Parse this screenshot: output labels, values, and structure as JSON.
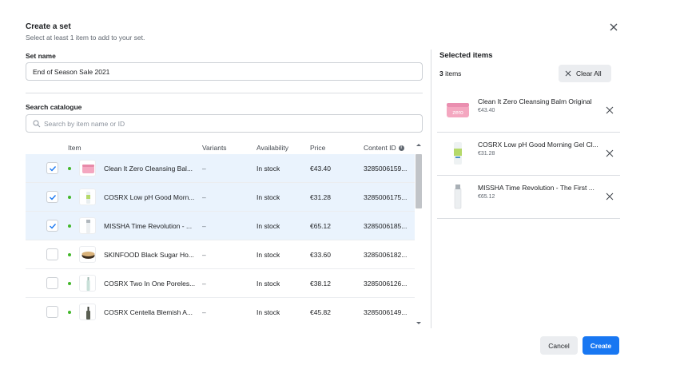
{
  "dialog": {
    "title": "Create a set",
    "subtitle": "Select at least 1 item to add to your set."
  },
  "set_name": {
    "label": "Set name",
    "value": "End of Season Sale 2021"
  },
  "search": {
    "label": "Search catalogue",
    "placeholder": "Search by item name or ID"
  },
  "table": {
    "headers": {
      "item": "Item",
      "variants": "Variants",
      "availability": "Availability",
      "price": "Price",
      "content_id": "Content ID"
    },
    "rows": [
      {
        "name": "Clean It Zero Cleansing Bal...",
        "variants": "–",
        "availability": "In stock",
        "price": "€43.40",
        "content_id": "3285006159...",
        "selected": true
      },
      {
        "name": "COSRX Low pH Good Morn...",
        "variants": "–",
        "availability": "In stock",
        "price": "€31.28",
        "content_id": "3285006175...",
        "selected": true
      },
      {
        "name": "MISSHA Time Revolution - ...",
        "variants": "–",
        "availability": "In stock",
        "price": "€65.12",
        "content_id": "3285006185...",
        "selected": true
      },
      {
        "name": "SKINFOOD Black Sugar Ho...",
        "variants": "–",
        "availability": "In stock",
        "price": "€33.60",
        "content_id": "3285006182...",
        "selected": false
      },
      {
        "name": "COSRX Two In One Poreles...",
        "variants": "–",
        "availability": "In stock",
        "price": "€38.12",
        "content_id": "3285006126...",
        "selected": false
      },
      {
        "name": "COSRX Centella Blemish A...",
        "variants": "–",
        "availability": "In stock",
        "price": "€45.82",
        "content_id": "3285006149...",
        "selected": false
      }
    ]
  },
  "selected_panel": {
    "title": "Selected items",
    "count": "3",
    "count_suffix": " items",
    "clear_all_label": "Clear All",
    "items": [
      {
        "name": "Clean It Zero Cleansing Balm Original",
        "price": "€43.40"
      },
      {
        "name": "COSRX Low pH Good Morning Gel Cl...",
        "price": "€31.28"
      },
      {
        "name": "MISSHA Time Revolution - The First ...",
        "price": "€65.12"
      }
    ]
  },
  "footer": {
    "cancel_label": "Cancel",
    "create_label": "Create"
  },
  "colors": {
    "primary": "#1877f2",
    "selected_row": "#eaf3fd",
    "in_stock_dot": "#42b72a"
  }
}
